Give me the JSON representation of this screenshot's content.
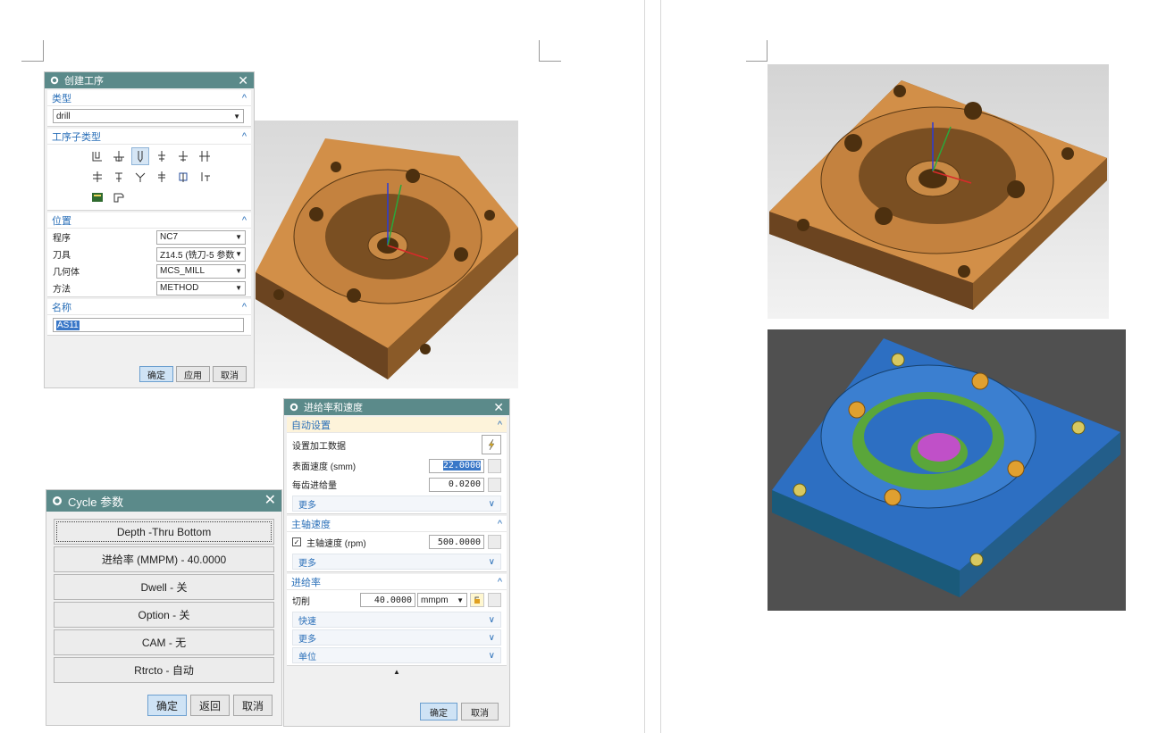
{
  "dialog_create": {
    "title": "创建工序",
    "type_section": "类型",
    "type_value": "drill",
    "subtype_section": "工序子类型",
    "location_section": "位置",
    "rows": [
      {
        "label": "程序",
        "value": "NC7"
      },
      {
        "label": "刀具",
        "value": "Z14.5 (铣刀-5 参数)"
      },
      {
        "label": "几何体",
        "value": "MCS_MILL"
      },
      {
        "label": "方法",
        "value": "METHOD"
      }
    ],
    "name_section": "名称",
    "name_value": "AS11",
    "ok": "确定",
    "apply": "应用",
    "cancel": "取消"
  },
  "dialog_cycle": {
    "title": "Cycle 参数",
    "buttons": [
      "Depth -Thru Bottom",
      "进给率 (MMPM) - 40.0000",
      "Dwell - 关",
      "Option - 关",
      "CAM - 无",
      "Rtrcto - 自动"
    ],
    "ok": "确定",
    "back": "返回",
    "cancel": "取消"
  },
  "dialog_feed": {
    "title": "进给率和速度",
    "auto_section": "自动设置",
    "set_data_label": "设置加工数据",
    "surface_speed_label": "表面速度 (smm)",
    "surface_speed_value": "22.0000",
    "feed_per_tooth_label": "每齿进给量",
    "feed_per_tooth_value": "0.0200",
    "more": "更多",
    "spindle_section": "主轴速度",
    "spindle_label": "主轴速度 (rpm)",
    "spindle_value": "500.0000",
    "feed_section": "进给率",
    "cut_label": "切削",
    "cut_value": "40.0000",
    "cut_unit": "mmpm",
    "rapid": "快速",
    "more2": "更多",
    "units": "单位",
    "ok": "确定",
    "cancel": "取消"
  },
  "colors": {
    "titlebar": "#5b8a8a",
    "accent": "#2a6fb8",
    "part_orange": "#c98a45",
    "part_blue": "#2d6fc2",
    "part_green": "#5aa63a",
    "part_magenta": "#c050c8"
  }
}
